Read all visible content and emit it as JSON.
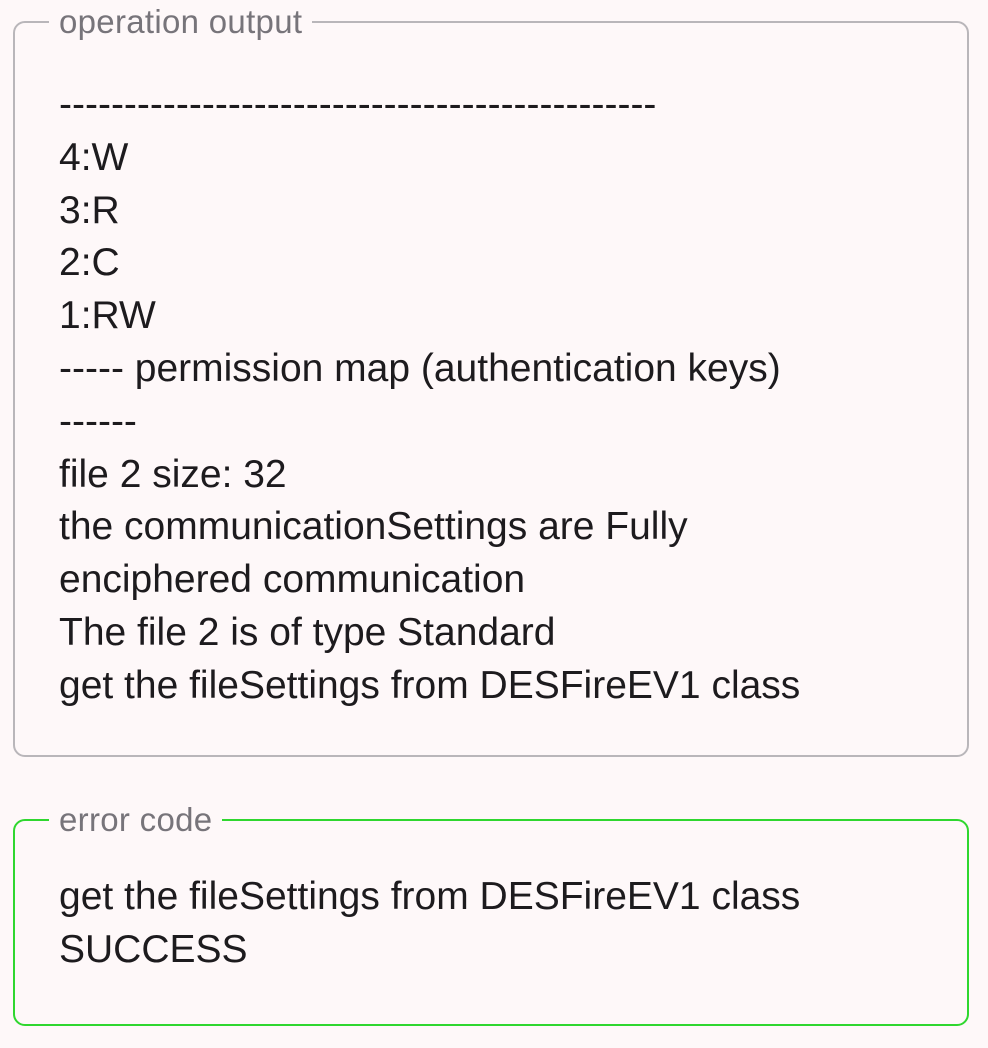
{
  "output_field": {
    "label": "operation output",
    "lines": [
      "----------------------------------------------",
      "4:W",
      "3:R",
      "2:C",
      "1:RW",
      "----- permission map (authentication keys)",
      "------",
      "file 2 size: 32",
      "the communicationSettings are Fully",
      "enciphered communication",
      "The file 2 is of type Standard",
      "get the fileSettings from DESFireEV1 class"
    ]
  },
  "error_field": {
    "label": "error code",
    "lines": [
      "get the fileSettings from DESFireEV1 class",
      "SUCCESS"
    ]
  },
  "colors": {
    "background": "#fef8f9",
    "output_border": "#b9b6ba",
    "error_border": "#2fd72f",
    "label_text": "#77747a",
    "body_text": "#1d1b1e"
  }
}
